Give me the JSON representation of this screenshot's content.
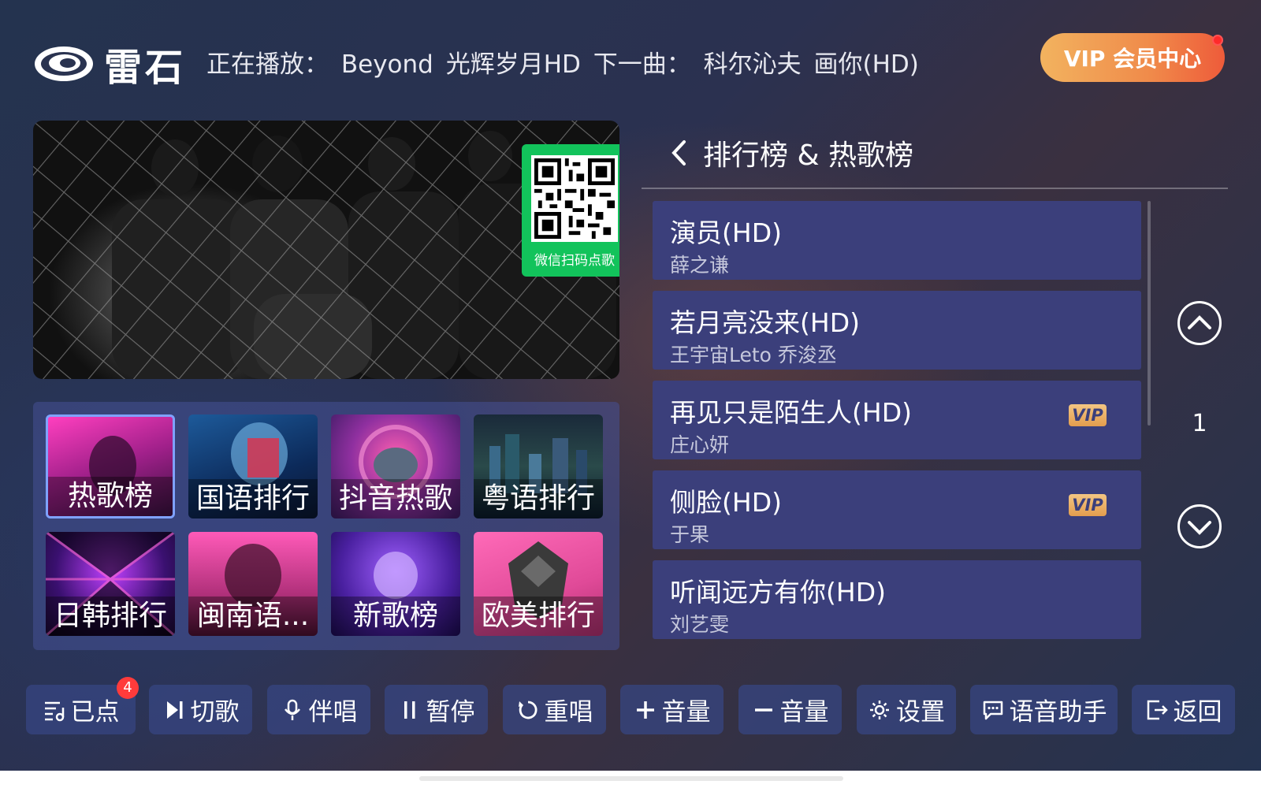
{
  "header": {
    "logo_text": "雷石",
    "now_playing_label": "正在播放：",
    "now_artist": "Beyond",
    "now_song": "光辉岁月HD",
    "next_label": "下一曲：",
    "next_artist": "科尔沁夫",
    "next_song": "画你(HD)",
    "vip_button": "VIP 会员中心"
  },
  "video": {
    "qr_caption": "微信扫码点歌"
  },
  "categories": [
    {
      "label": "热歌榜",
      "active": true
    },
    {
      "label": "国语排行"
    },
    {
      "label": "抖音热歌"
    },
    {
      "label": "粤语排行"
    },
    {
      "label": "日韩排行"
    },
    {
      "label": "闽南语..."
    },
    {
      "label": "新歌榜"
    },
    {
      "label": "欧美排行"
    }
  ],
  "list": {
    "title": "排行榜 & 热歌榜",
    "page": "1",
    "songs": [
      {
        "title": "演员(HD)",
        "artist": "薛之谦",
        "vip": false
      },
      {
        "title": "若月亮没来(HD)",
        "artist": "王宇宙Leto 乔浚丞",
        "vip": false
      },
      {
        "title": "再见只是陌生人(HD)",
        "artist": "庄心妍",
        "vip": true,
        "vip_label": "VIP"
      },
      {
        "title": "侧脸(HD)",
        "artist": "于果",
        "vip": true,
        "vip_label": "VIP"
      },
      {
        "title": "听闻远方有你(HD)",
        "artist": "刘艺雯",
        "vip": false
      }
    ]
  },
  "toolbar": {
    "queued": "已点",
    "queued_count": "4",
    "skip": "切歌",
    "accompany": "伴唱",
    "pause": "暂停",
    "replay": "重唱",
    "vol_up": "音量",
    "vol_down": "音量",
    "settings": "设置",
    "voice": "语音助手",
    "back": "返回"
  },
  "colors": {
    "panel": "#3b3f7b",
    "vip_gradient_start": "#f2b35f",
    "vip_gradient_end": "#ee5b3a",
    "qr_green": "#12c35b",
    "badge_red": "#ff3b3b"
  }
}
